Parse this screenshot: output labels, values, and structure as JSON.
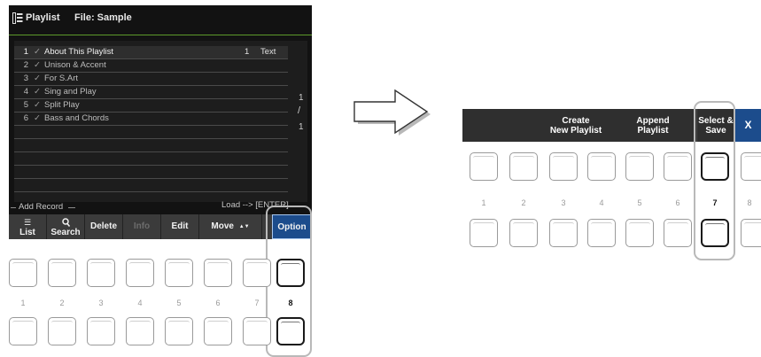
{
  "left_screen": {
    "title": "Playlist",
    "file_label": "File: Sample",
    "records": [
      {
        "num": "1",
        "check": "✓",
        "name": "About This Playlist",
        "count": "1",
        "type": "Text",
        "selected": true
      },
      {
        "num": "2",
        "check": "✓",
        "name": "Unison & Accent"
      },
      {
        "num": "3",
        "check": "✓",
        "name": "For S.Art"
      },
      {
        "num": "4",
        "check": "✓",
        "name": "Sing and Play"
      },
      {
        "num": "5",
        "check": "✓",
        "name": "Split Play"
      },
      {
        "num": "6",
        "check": "✓",
        "name": "Bass and Chords"
      }
    ],
    "page_current": "1",
    "page_separator": "/",
    "page_total": "1",
    "add_record_label": "Add Record",
    "load_hint": "Load --> [ENTER]",
    "buttons": {
      "list": "List",
      "search": "Search",
      "delete": "Delete",
      "info": "Info",
      "edit": "Edit",
      "move": "Move",
      "move_glyph": "▲▼",
      "option": "Option"
    }
  },
  "right_screen": {
    "buttons": {
      "create_line1": "Create",
      "create_line2": "New Playlist",
      "append_line1": "Append",
      "append_line2": "Playlist",
      "select_line1": "Select &",
      "select_line2": "Save",
      "close": "X"
    }
  },
  "left_keys": [
    "1",
    "2",
    "3",
    "4",
    "5",
    "6",
    "7",
    "8"
  ],
  "right_keys": [
    "1",
    "2",
    "3",
    "4",
    "5",
    "6",
    "7",
    "8"
  ],
  "colors": {
    "screen_bg": "#121212",
    "accent_blue": "#1c4c8c",
    "title_rule_green": "#5c9a2a",
    "highlight_frame": "#b9b9b9"
  }
}
